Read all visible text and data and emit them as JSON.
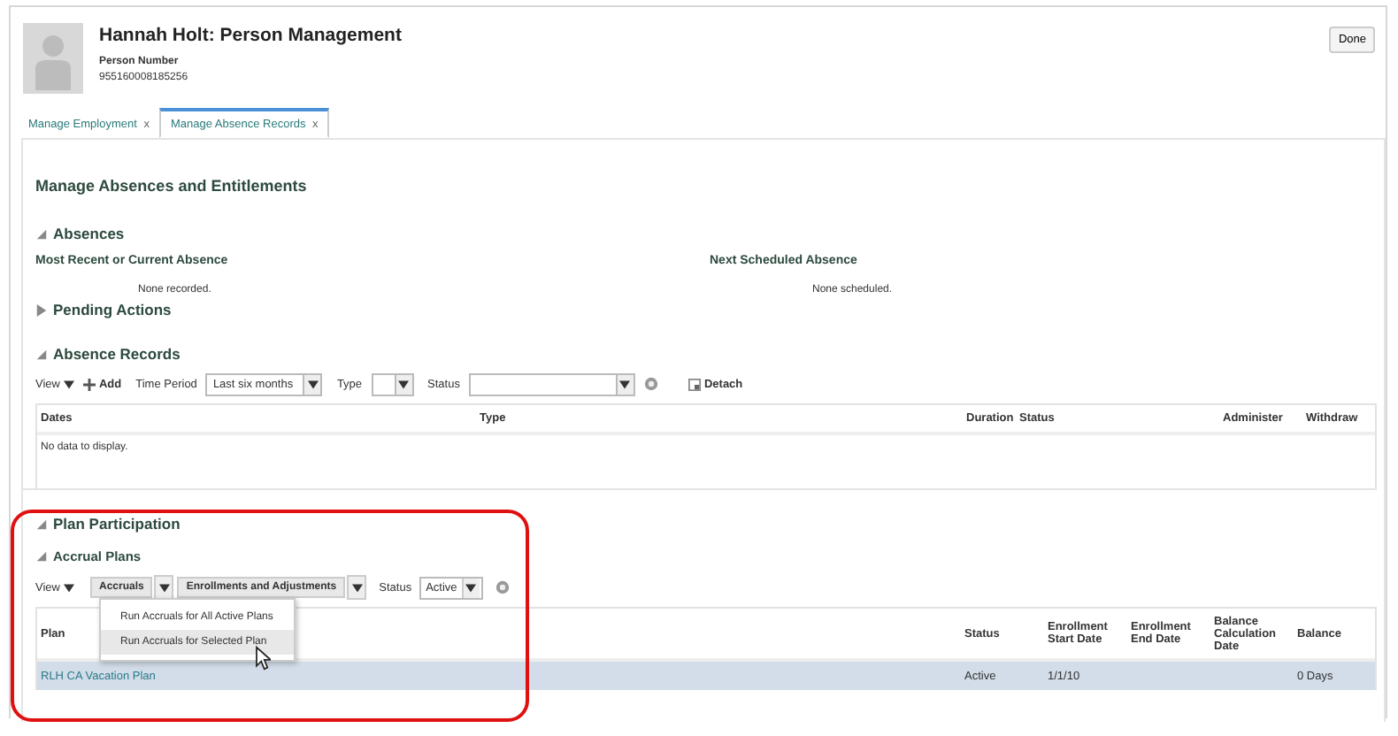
{
  "header": {
    "name": "Hannah Holt: Person Management",
    "number_label": "Person Number",
    "number": "955160008185256",
    "done_button": "Done"
  },
  "tabs": [
    {
      "label": "Manage Employment",
      "close": "x",
      "selected": false
    },
    {
      "label": "Manage Absence Records",
      "close": "x",
      "selected": true
    }
  ],
  "page_title": "Manage Absences and Entitlements",
  "absences": {
    "title": "Absences",
    "expanded": true,
    "columns": [
      {
        "heading": "Most Recent or Current Absence",
        "empty_text": "None recorded."
      },
      {
        "heading": "Next Scheduled Absence",
        "empty_text": "None scheduled."
      }
    ]
  },
  "pending_actions": {
    "title": "Pending Actions",
    "expanded": false
  },
  "absence_records": {
    "title": "Absence Records",
    "expanded": true,
    "toolbar": {
      "view": "View",
      "add": "Add",
      "time_period_label": "Time Period",
      "time_period_value": "Last six months",
      "type_label": "Type",
      "status_label": "Status",
      "detach": "Detach"
    },
    "columns": [
      "Dates",
      "Type",
      "Duration",
      "Status",
      "Administer",
      "Withdraw"
    ],
    "empty_text": "No data to display."
  },
  "plan_participation": {
    "title": "Plan Participation",
    "expanded": true
  },
  "accrual_plans": {
    "title": "Accrual Plans",
    "expanded": true,
    "toolbar": {
      "view": "View",
      "accruals": "Accruals",
      "enrollments": "Enrollments and Adjustments",
      "status_label": "Status",
      "status_value": "Active"
    },
    "menu": [
      {
        "label": "Run Accruals for All Active Plans",
        "selected": false
      },
      {
        "label": "Run Accruals for Selected Plan",
        "selected": true
      }
    ],
    "columns": [
      "Plan",
      "Status",
      "Enrollment Start Date",
      "Enrollment End Date",
      "Balance Calculation Date",
      "Balance"
    ],
    "rows": [
      {
        "selected": true,
        "cells": [
          "RLH CA Vacation Plan",
          "Active",
          "1/1/10",
          "",
          "",
          "0 Days"
        ]
      }
    ]
  }
}
